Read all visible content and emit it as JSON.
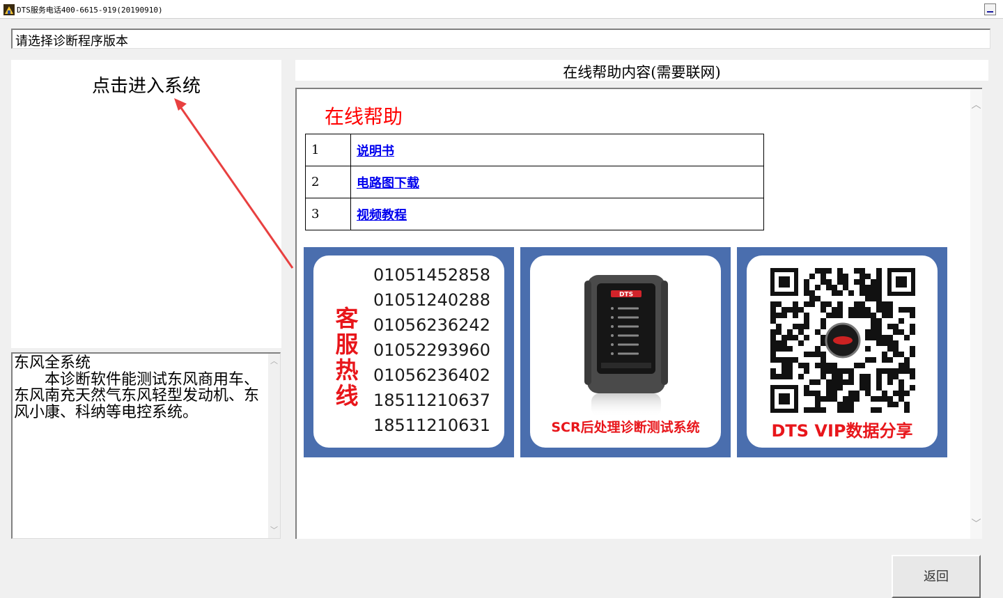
{
  "window": {
    "title": "DTS服务电话400-6615-919(20190910)"
  },
  "prompt": "请选择诊断程序版本",
  "left_panel": {
    "enter_system": "点击进入系统"
  },
  "description": {
    "title": "东风全系统",
    "body": "　　本诊断软件能测试东风商用车、东风南充天然气东风轻型发动机、东风小康、科纳等电控系统。"
  },
  "help": {
    "header": "在线帮助内容(需要联网)",
    "title": "在线帮助",
    "rows": [
      {
        "num": "1",
        "label": "说明书"
      },
      {
        "num": "2",
        "label": "电路图下载"
      },
      {
        "num": "3",
        "label": "视频教程"
      }
    ]
  },
  "banners": {
    "hotline_label": "客服热线",
    "phones": [
      "01051452858",
      "01051240288",
      "01056236242",
      "01052293960",
      "01056236402",
      "18511210637",
      "18511210631"
    ],
    "device_logo": "DTS",
    "device_caption": "SCR后处理诊断测试系统",
    "qr_caption": "DTS VIP数据分享"
  },
  "buttons": {
    "return": "返回"
  },
  "colors": {
    "banner_blue": "#4a6eae",
    "hotline_red": "#e8161b",
    "link_blue": "#0000ee"
  }
}
